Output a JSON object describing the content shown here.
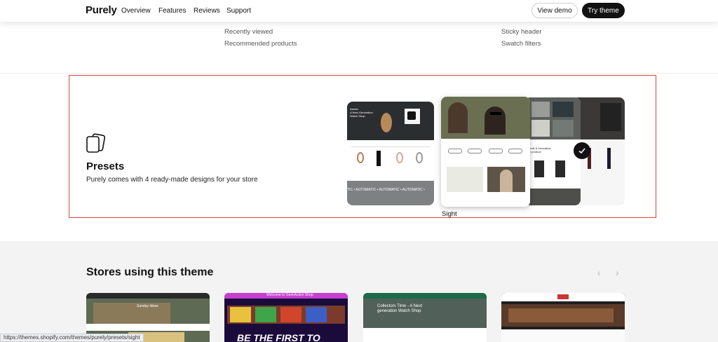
{
  "header": {
    "brand": "Purely",
    "nav": [
      "Overview",
      "Features",
      "Reviews",
      "Support"
    ],
    "view_demo": "View demo",
    "try_theme": "Try theme"
  },
  "features": {
    "col1": [
      "Recently viewed",
      "Recommended products"
    ],
    "col3": [
      "Sticky header",
      "Swatch filters"
    ]
  },
  "presets": {
    "title": "Presets",
    "subtitle": "Purely comes with 4 ready-made designs for your store",
    "selected_label": "Sight",
    "card_texts": {
      "a_hero": "Atomic\nA Next Generation\nWatch Shop",
      "a_ticker": "TIC  • AUTOMATIC •  AUTOMATIC •  AUTOMATIC  •",
      "c_text": "ands & innovative\nin product"
    }
  },
  "stores": {
    "title": "Stores using this theme",
    "prev": "‹",
    "next": "›",
    "thumbs": [
      {
        "label": "Sunday Ideas"
      },
      {
        "label": "BE THE FIRST TO",
        "top": "Welcome to GeekAction Shop"
      },
      {
        "label": "Collectors Time - A Next generation Watch Shop"
      },
      {
        "label": ""
      }
    ]
  },
  "status_url": "https://themes.shopify.com/themes/purely/presets/sight",
  "colors": {
    "accent_dark": "#121212",
    "highlight_border": "#d94444",
    "section_bg": "#f3f3f3"
  }
}
